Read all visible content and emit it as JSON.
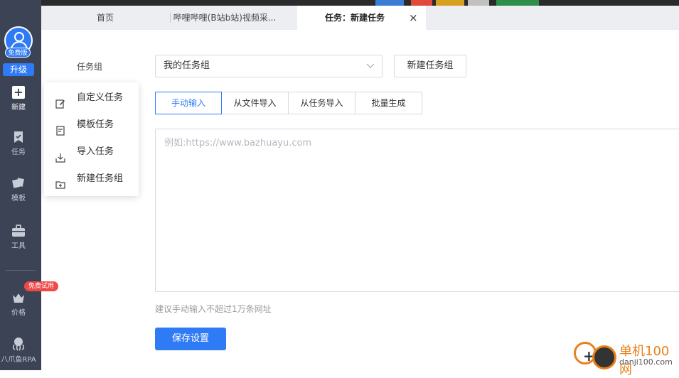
{
  "tabs": {
    "home": "首页",
    "bilibili": "哔哩哔哩(B站b站)视频采...",
    "current": "任务：新建任务",
    "close_icon": "×"
  },
  "sidebar": {
    "free_tag": "免费版",
    "upgrade": "升级",
    "new": "新建",
    "task": "任务",
    "template": "模板",
    "tools": "工具",
    "trial_badge": "免费试用",
    "price": "价格",
    "rpa": "八爪鱼RPA"
  },
  "flyout": {
    "items": [
      {
        "label": "自定义任务",
        "icon": "edit-icon"
      },
      {
        "label": "模板任务",
        "icon": "template-doc-icon"
      },
      {
        "label": "导入任务",
        "icon": "import-icon"
      },
      {
        "label": "新建任务组",
        "icon": "folder-plus-icon"
      }
    ]
  },
  "form": {
    "group_label": "任务组",
    "group_value": "我的任务组",
    "new_group_button": "新建任务组",
    "input_tabs": [
      "手动输入",
      "从文件导入",
      "从任务导入",
      "批量生成"
    ],
    "active_tab_index": 0,
    "url_placeholder": "例如:https://www.bazhuayu.com",
    "hint": "建议手动输入不超过1万条网址",
    "save_button": "保存设置"
  },
  "watermark": {
    "cn": "单机100网",
    "en": "danji100.com"
  },
  "colors": {
    "accent": "#2f7bf5",
    "sidebar": "#3b4354",
    "badge": "#f04848",
    "watermark": "#e8811c"
  }
}
